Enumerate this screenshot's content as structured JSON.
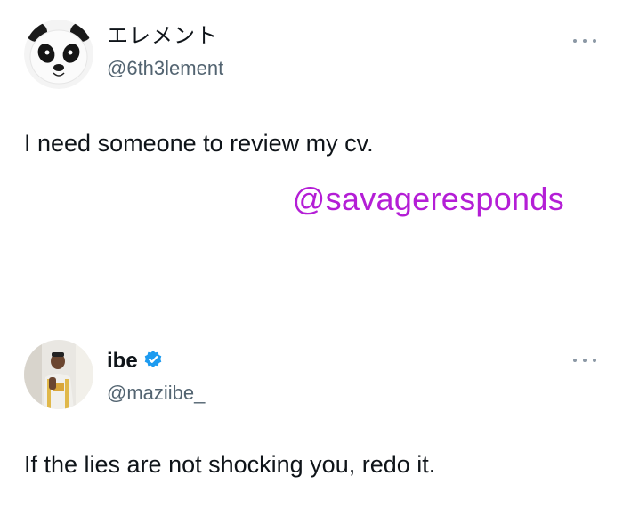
{
  "tweets": [
    {
      "display_name": "エレメント",
      "handle": "@6th3lement",
      "text": "I need someone to review my cv.",
      "avatar": "panda-avatar",
      "verified": false
    },
    {
      "display_name": "ibe",
      "handle": "@maziibe_",
      "text": "If the lies are not shocking you, redo it.",
      "avatar": "person-photo-avatar",
      "verified": true
    }
  ],
  "watermark": "@savageresponds",
  "colors": {
    "text_primary": "#0f1419",
    "text_secondary": "#536471",
    "verified_blue": "#1d9bf0",
    "watermark": "#b41ed6"
  },
  "icons": {
    "more": "more-options-icon",
    "verified": "verified-badge-icon"
  }
}
